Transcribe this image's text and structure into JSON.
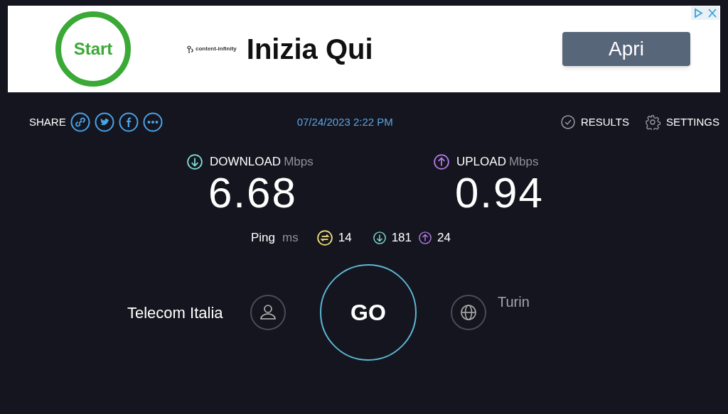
{
  "ad": {
    "badge": "Start",
    "logo": "content-infinity",
    "headline": "Inizia Qui",
    "button": "Apri"
  },
  "toolbar": {
    "share_label": "SHARE",
    "date": "07/24/2023 2:22 PM",
    "links": [
      {
        "kind": "results",
        "label": "RESULTS"
      },
      {
        "kind": "settings",
        "label": "SETTINGS"
      }
    ]
  },
  "speeds": [
    {
      "kind": "download",
      "label": "DOWNLOAD",
      "unit": "Mbps",
      "value": "6.68"
    },
    {
      "kind": "upload",
      "label": "UPLOAD",
      "unit": "Mbps",
      "value": "0.94"
    }
  ],
  "ping": {
    "label": "Ping",
    "unit": "ms",
    "items": [
      {
        "kind": "ping",
        "value": "14"
      },
      {
        "kind": "download",
        "value": "181"
      },
      {
        "kind": "upload",
        "value": "24"
      }
    ]
  },
  "provider": "Telecom Italia",
  "go": "GO",
  "server": "Turin"
}
